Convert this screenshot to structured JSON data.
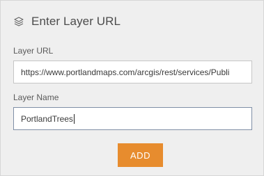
{
  "header": {
    "icon": "layers-icon",
    "title": "Enter Layer URL"
  },
  "form": {
    "url_label": "Layer URL",
    "url_value": "https://www.portlandmaps.com/arcgis/rest/services/Publi",
    "name_label": "Layer Name",
    "name_value": "PortlandTrees",
    "add_label": "ADD"
  },
  "colors": {
    "panel_bg": "#efefef",
    "accent": "#e78c2e",
    "active_border": "#7f8fa6"
  }
}
